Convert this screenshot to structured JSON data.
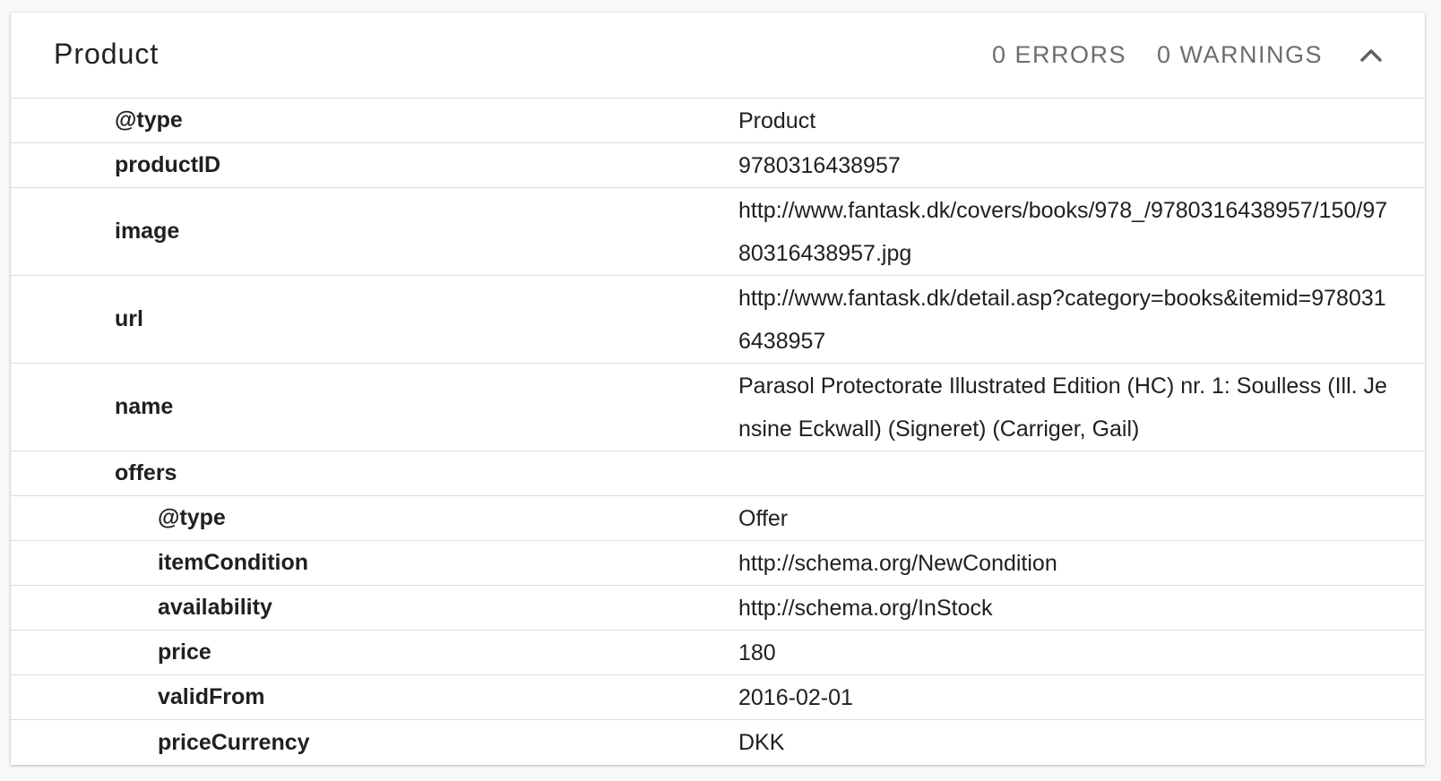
{
  "panel": {
    "title": "Product",
    "errors_label": "0 ERRORS",
    "warnings_label": "0 WARNINGS",
    "collapse_icon": "chevron-up-icon"
  },
  "rows": [
    {
      "key": "@type",
      "value": "Product"
    },
    {
      "key": "productID",
      "value": "9780316438957"
    },
    {
      "key": "image",
      "value": "http://www.fantask.dk/covers/books/978_/9780316438957/150/9780316438957.jpg"
    },
    {
      "key": "url",
      "value": "http://www.fantask.dk/detail.asp?category=books&itemid=9780316438957"
    },
    {
      "key": "name",
      "value": "Parasol Protectorate Illustrated Edition (HC) nr. 1: Soulless (Ill. Jensine Eckwall) (Signeret) (Carriger, Gail)"
    },
    {
      "key": "offers",
      "value": ""
    },
    {
      "key": "@type",
      "value": "Offer"
    },
    {
      "key": "itemCondition",
      "value": "http://schema.org/NewCondition"
    },
    {
      "key": "availability",
      "value": "http://schema.org/InStock"
    },
    {
      "key": "price",
      "value": "180"
    },
    {
      "key": "validFrom",
      "value": "2016-02-01"
    },
    {
      "key": "priceCurrency",
      "value": "DKK"
    }
  ]
}
